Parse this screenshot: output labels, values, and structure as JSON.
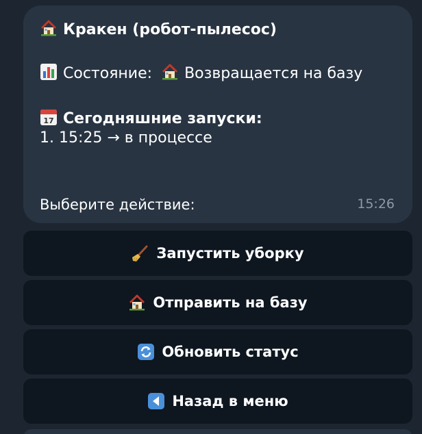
{
  "message": {
    "title": "Кракен (робот-пылесос)",
    "title_icon": "house-icon",
    "status_label": "Состояние:",
    "status_icon": "bar-chart-icon",
    "status_value": "Возвращается на базу",
    "status_value_icon": "house-icon",
    "runs_heading": "Сегодняшние запуски:",
    "runs_icon": "calendar-icon",
    "runs": [
      "1. 15:25 → в процессе"
    ],
    "prompt": "Выберите действие:",
    "time": "15:26"
  },
  "buttons": [
    {
      "label": "Запустить уборку",
      "icon": "broom-icon"
    },
    {
      "label": "Отправить на базу",
      "icon": "house-icon"
    },
    {
      "label": "Обновить статус",
      "icon": "refresh-icon"
    },
    {
      "label": "Назад в меню",
      "icon": "back-arrow-icon"
    }
  ],
  "colors": {
    "background": "#1c2530",
    "bubble": "#283442",
    "button": "#0e1620",
    "text": "#ffffff",
    "time": "#8e9aa6"
  }
}
